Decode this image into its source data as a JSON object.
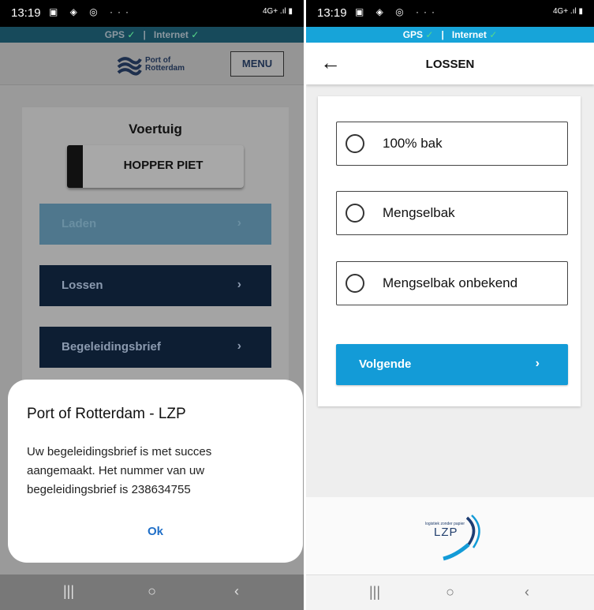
{
  "left": {
    "status": {
      "time": "13:19",
      "glyphs": "▣ ◈ ◎ ···",
      "signal": "4G+ .ıl ▮"
    },
    "connection": {
      "gps": "GPS",
      "separator": "|",
      "internet": "Internet",
      "check": "✓"
    },
    "header": {
      "logo_line1": "Port of",
      "logo_line2": "Rotterdam",
      "menu_label": "MENU"
    },
    "card": {
      "title": "Voertuig",
      "vehicle": "HOPPER PIET",
      "actions": [
        {
          "label": "Laden",
          "chevron": "›"
        },
        {
          "label": "Lossen",
          "chevron": "›"
        },
        {
          "label": "Begeleidingsbrief",
          "chevron": "›"
        }
      ]
    },
    "dialog": {
      "title": "Port of Rotterdam - LZP",
      "message": "Uw begeleidingsbrief is met succes aangemaakt. Het nummer van uw begeleidingsbrief is 238634755",
      "ok": "Ok"
    },
    "nav": {
      "recents": "|||",
      "home": "○",
      "back": "‹"
    }
  },
  "right": {
    "status": {
      "time": "13:19",
      "glyphs": "▣ ◈ ◎ ···",
      "signal": "4G+ .ıl ▮"
    },
    "connection": {
      "gps": "GPS",
      "separator": "|",
      "internet": "Internet",
      "check": "✓"
    },
    "header": {
      "back": "←",
      "title": "LOSSEN"
    },
    "options": [
      {
        "label": "100% bak",
        "selected": false
      },
      {
        "label": "Mengselbak",
        "selected": false
      },
      {
        "label": "Mengselbak onbekend",
        "selected": false
      }
    ],
    "next": {
      "label": "Volgende",
      "chevron": "›"
    },
    "footer": {
      "logo_tag": "logistiek zonder papier",
      "logo_text": "LZP"
    },
    "nav": {
      "recents": "|||",
      "home": "○",
      "back": "‹"
    }
  },
  "colors": {
    "primary_blue": "#139bd7",
    "dark_navy": "#0d1e33",
    "gps_bar": "#17a4d9",
    "check_green": "#57d98a"
  }
}
